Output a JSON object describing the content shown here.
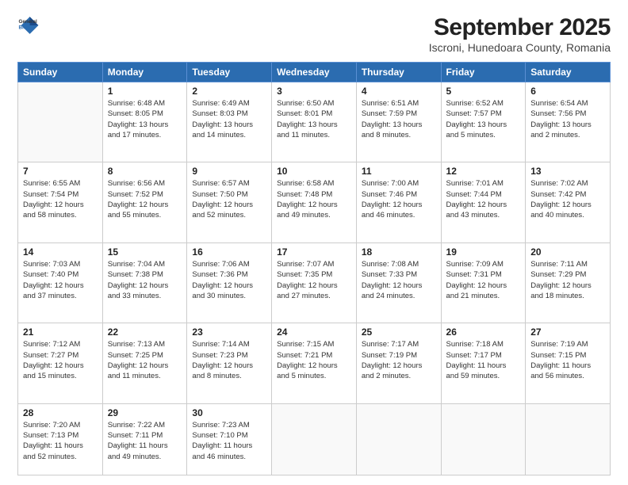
{
  "header": {
    "logo_general": "General",
    "logo_blue": "Blue",
    "title": "September 2025",
    "subtitle": "Iscroni, Hunedoara County, Romania"
  },
  "columns": [
    "Sunday",
    "Monday",
    "Tuesday",
    "Wednesday",
    "Thursday",
    "Friday",
    "Saturday"
  ],
  "weeks": [
    [
      {
        "num": "",
        "info": ""
      },
      {
        "num": "1",
        "info": "Sunrise: 6:48 AM\nSunset: 8:05 PM\nDaylight: 13 hours\nand 17 minutes."
      },
      {
        "num": "2",
        "info": "Sunrise: 6:49 AM\nSunset: 8:03 PM\nDaylight: 13 hours\nand 14 minutes."
      },
      {
        "num": "3",
        "info": "Sunrise: 6:50 AM\nSunset: 8:01 PM\nDaylight: 13 hours\nand 11 minutes."
      },
      {
        "num": "4",
        "info": "Sunrise: 6:51 AM\nSunset: 7:59 PM\nDaylight: 13 hours\nand 8 minutes."
      },
      {
        "num": "5",
        "info": "Sunrise: 6:52 AM\nSunset: 7:57 PM\nDaylight: 13 hours\nand 5 minutes."
      },
      {
        "num": "6",
        "info": "Sunrise: 6:54 AM\nSunset: 7:56 PM\nDaylight: 13 hours\nand 2 minutes."
      }
    ],
    [
      {
        "num": "7",
        "info": "Sunrise: 6:55 AM\nSunset: 7:54 PM\nDaylight: 12 hours\nand 58 minutes."
      },
      {
        "num": "8",
        "info": "Sunrise: 6:56 AM\nSunset: 7:52 PM\nDaylight: 12 hours\nand 55 minutes."
      },
      {
        "num": "9",
        "info": "Sunrise: 6:57 AM\nSunset: 7:50 PM\nDaylight: 12 hours\nand 52 minutes."
      },
      {
        "num": "10",
        "info": "Sunrise: 6:58 AM\nSunset: 7:48 PM\nDaylight: 12 hours\nand 49 minutes."
      },
      {
        "num": "11",
        "info": "Sunrise: 7:00 AM\nSunset: 7:46 PM\nDaylight: 12 hours\nand 46 minutes."
      },
      {
        "num": "12",
        "info": "Sunrise: 7:01 AM\nSunset: 7:44 PM\nDaylight: 12 hours\nand 43 minutes."
      },
      {
        "num": "13",
        "info": "Sunrise: 7:02 AM\nSunset: 7:42 PM\nDaylight: 12 hours\nand 40 minutes."
      }
    ],
    [
      {
        "num": "14",
        "info": "Sunrise: 7:03 AM\nSunset: 7:40 PM\nDaylight: 12 hours\nand 37 minutes."
      },
      {
        "num": "15",
        "info": "Sunrise: 7:04 AM\nSunset: 7:38 PM\nDaylight: 12 hours\nand 33 minutes."
      },
      {
        "num": "16",
        "info": "Sunrise: 7:06 AM\nSunset: 7:36 PM\nDaylight: 12 hours\nand 30 minutes."
      },
      {
        "num": "17",
        "info": "Sunrise: 7:07 AM\nSunset: 7:35 PM\nDaylight: 12 hours\nand 27 minutes."
      },
      {
        "num": "18",
        "info": "Sunrise: 7:08 AM\nSunset: 7:33 PM\nDaylight: 12 hours\nand 24 minutes."
      },
      {
        "num": "19",
        "info": "Sunrise: 7:09 AM\nSunset: 7:31 PM\nDaylight: 12 hours\nand 21 minutes."
      },
      {
        "num": "20",
        "info": "Sunrise: 7:11 AM\nSunset: 7:29 PM\nDaylight: 12 hours\nand 18 minutes."
      }
    ],
    [
      {
        "num": "21",
        "info": "Sunrise: 7:12 AM\nSunset: 7:27 PM\nDaylight: 12 hours\nand 15 minutes."
      },
      {
        "num": "22",
        "info": "Sunrise: 7:13 AM\nSunset: 7:25 PM\nDaylight: 12 hours\nand 11 minutes."
      },
      {
        "num": "23",
        "info": "Sunrise: 7:14 AM\nSunset: 7:23 PM\nDaylight: 12 hours\nand 8 minutes."
      },
      {
        "num": "24",
        "info": "Sunrise: 7:15 AM\nSunset: 7:21 PM\nDaylight: 12 hours\nand 5 minutes."
      },
      {
        "num": "25",
        "info": "Sunrise: 7:17 AM\nSunset: 7:19 PM\nDaylight: 12 hours\nand 2 minutes."
      },
      {
        "num": "26",
        "info": "Sunrise: 7:18 AM\nSunset: 7:17 PM\nDaylight: 11 hours\nand 59 minutes."
      },
      {
        "num": "27",
        "info": "Sunrise: 7:19 AM\nSunset: 7:15 PM\nDaylight: 11 hours\nand 56 minutes."
      }
    ],
    [
      {
        "num": "28",
        "info": "Sunrise: 7:20 AM\nSunset: 7:13 PM\nDaylight: 11 hours\nand 52 minutes."
      },
      {
        "num": "29",
        "info": "Sunrise: 7:22 AM\nSunset: 7:11 PM\nDaylight: 11 hours\nand 49 minutes."
      },
      {
        "num": "30",
        "info": "Sunrise: 7:23 AM\nSunset: 7:10 PM\nDaylight: 11 hours\nand 46 minutes."
      },
      {
        "num": "",
        "info": ""
      },
      {
        "num": "",
        "info": ""
      },
      {
        "num": "",
        "info": ""
      },
      {
        "num": "",
        "info": ""
      }
    ]
  ]
}
